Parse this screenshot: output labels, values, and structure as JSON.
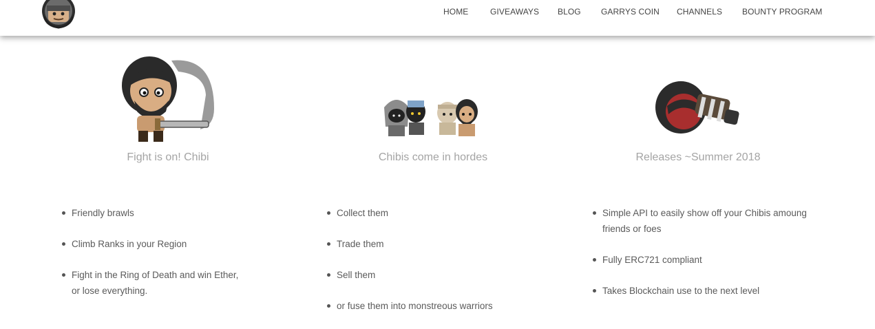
{
  "nav": {
    "items": [
      "HOME",
      "GIVEAWAYS",
      "BLOG",
      "GARRYS COIN",
      "CHANNELS",
      "BOUNTY PROGRAM"
    ]
  },
  "features": [
    {
      "title": "Fight is on! Chibi",
      "bullets": [
        "Friendly brawls",
        "Climb Ranks in your Region",
        "Fight in the Ring of Death and win Ether, or lose everything."
      ]
    },
    {
      "title": "Chibis come in hordes",
      "bullets": [
        "Collect them",
        "Trade them",
        "Sell them",
        "or fuse them into monstreous warriors"
      ]
    },
    {
      "title": "Releases ~Summer 2018",
      "bullets": [
        "Simple API to easily show off your Chibis amoung friends or foes",
        "Fully ERC721 compliant",
        "Takes Blockchain use to the next level"
      ]
    }
  ]
}
